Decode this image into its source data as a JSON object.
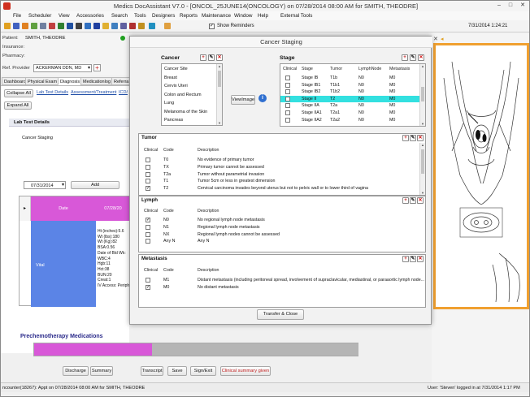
{
  "window": {
    "title": "Medics DocAssistant V7.0 - [ONCOL_25JUNE14(ONCOLOGY) on 07/28/2014 08:00 AM for SMITH, THEODRE]",
    "minimize": "–",
    "maximize": "□",
    "close": "✕"
  },
  "menu": [
    "File",
    "Scheduler",
    "View",
    "Accessories",
    "Search",
    "Tools",
    "Designers",
    "Reports",
    "Maintenance",
    "Window",
    "Help",
    "External Tools"
  ],
  "toolbar": {
    "show_reminders_label": "Show Reminders",
    "datetime": "7/31/2014 1:24:21"
  },
  "patient": {
    "patient_label": "Patient:",
    "patient_value": "SMITH, THEODRE",
    "insurance_label": "Insurance:",
    "pharmacy_label": "Pharmacy:",
    "ref_provider_label": "Ref. Provider",
    "ref_provider_value": "ACKERMAN DDN, MD"
  },
  "tabs": [
    "Dashboard",
    "Physical Exam",
    "Diagnosis",
    "Medicationlog",
    "Referra"
  ],
  "left": {
    "collapse_all": "Collapse All",
    "expand_all": "Expand All",
    "link_lab": "Lab Test Details",
    "link_assessment": "Assessment/Treatment",
    "link_icd": "ICD/",
    "lab_section_title": "Lab Test Details",
    "cancer_staging_label": "Cancer Staging",
    "date_value": "07/31/2014",
    "add_button": "Add",
    "grid_date_header": "Date",
    "grid_date_value": "07/28/20",
    "vital_label": "Vital",
    "vitals": [
      "Ht (inches):5.6",
      "Wt (lbs):180",
      "Wt (Kg):82",
      "BSA:0.56",
      "Date of Bld Wk:",
      "WBC:4",
      "Hgb:11",
      "Hct:38",
      "BUN:20",
      "Creat:1",
      "IV Access: Periph"
    ],
    "premeds_title": "Prechemotherapy Medications"
  },
  "bottom_buttons": [
    "Discharge",
    "Summary",
    "Transcript",
    "Save",
    "Sign/Exit",
    "Clinical summary given"
  ],
  "status": {
    "left": "ncounter(18267): Appt on 07/28/2014 08:00 AM for SMITH, THEODRE",
    "right": "User: 'Steven' logged in at 7/31/2014 1:17 PM"
  },
  "dialog": {
    "title": "Cancer Staging",
    "cancer_header": "Cancer",
    "cancer_items": [
      "Cancer Site",
      "Breast",
      "Cervix Uteri",
      "Colon and Rectum",
      "Lung",
      "Melanoma of the Skin",
      "Pancreas"
    ],
    "view_image": "ViewImage",
    "stage_header": "Stage",
    "stage_columns": [
      "Clinical",
      "Stage",
      "Tumor",
      "LymphNode",
      "Metastasis"
    ],
    "stage_rows": [
      {
        "stage": "Stage IB",
        "tumor": "T1b",
        "node": "N0",
        "meta": "M0",
        "selected": false
      },
      {
        "stage": "Stage IB1",
        "tumor": "T1b1",
        "node": "N0",
        "meta": "M0",
        "selected": false
      },
      {
        "stage": "Stage IB2",
        "tumor": "T1b2",
        "node": "N0",
        "meta": "M0",
        "selected": false
      },
      {
        "stage": "Stage II",
        "tumor": "T2",
        "node": "N0",
        "meta": "M0",
        "selected": true
      },
      {
        "stage": "Stage IIA",
        "tumor": "T2a",
        "node": "N0",
        "meta": "M0",
        "selected": false
      },
      {
        "stage": "Stage IIA1",
        "tumor": "T2a1",
        "node": "N0",
        "meta": "M0",
        "selected": false
      },
      {
        "stage": "Stage IIA2",
        "tumor": "T2a2",
        "node": "N0",
        "meta": "M0",
        "selected": false
      }
    ],
    "tumor_title": "Tumor",
    "lymph_title": "Lymph",
    "metastasis_title": "Metastasis",
    "columns": [
      "Clinical",
      "Code",
      "Description"
    ],
    "tumor_rows": [
      {
        "code": "T0",
        "desc": "No evidence of primary tumor",
        "checked": false
      },
      {
        "code": "TX",
        "desc": "Primary tumor cannot be assessed",
        "checked": false
      },
      {
        "code": "T2a",
        "desc": "Tumor without parametrial invasion",
        "checked": false
      },
      {
        "code": "T1",
        "desc": "Tumor 5cm or less in greatest dimension",
        "checked": false
      },
      {
        "code": "T2",
        "desc": "Cervical carcinoma invades beyond uterus but not to pelvic wall or to lower third of vagina",
        "checked": true
      }
    ],
    "lymph_rows": [
      {
        "code": "N0",
        "desc": "No regional lymph node metastasis",
        "checked": true
      },
      {
        "code": "N1",
        "desc": "Regional lymph node metastasis",
        "checked": false
      },
      {
        "code": "NX",
        "desc": "Regional lymph nodes cannot be assessed",
        "checked": false
      },
      {
        "code": "Any N",
        "desc": "Any N",
        "checked": false
      }
    ],
    "meta_rows": [
      {
        "code": "M1",
        "desc": "Distant metastasis (including peritoneal spread, involvement of supraclavicular, mediastinal, or paraaortic lymph node...",
        "checked": false
      },
      {
        "code": "M0",
        "desc": "No distant metastasis",
        "checked": true
      }
    ],
    "transfer_close": "Transfer & Close"
  },
  "colors": {
    "selected_row": "#33e0e0",
    "grid_pink": "#d858d8",
    "grid_blue": "#5b84e6",
    "image_border": "#f0a030"
  }
}
